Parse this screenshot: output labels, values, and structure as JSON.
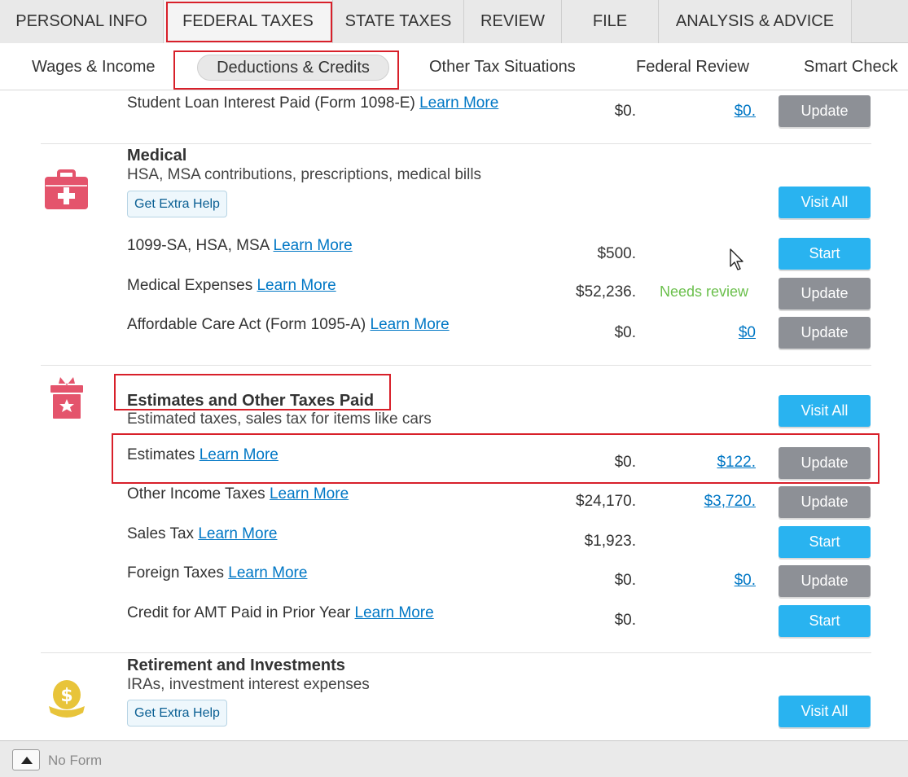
{
  "top_tabs": [
    {
      "label": "PERSONAL INFO"
    },
    {
      "label": "FEDERAL TAXES"
    },
    {
      "label": "STATE TAXES"
    },
    {
      "label": "REVIEW"
    },
    {
      "label": "FILE"
    },
    {
      "label": "ANALYSIS & ADVICE"
    }
  ],
  "active_top_tab": "FEDERAL TAXES",
  "sub_nav": [
    {
      "label": "Wages & Income"
    },
    {
      "label": "Deductions & Credits"
    },
    {
      "label": "Other Tax Situations"
    },
    {
      "label": "Federal Review"
    },
    {
      "label": "Smart Check"
    }
  ],
  "active_sub_tab": "Deductions & Credits",
  "learn_more": "Learn More",
  "student_loan_row": {
    "label": "Student Loan Interest Paid (Form 1098-E)",
    "amount": "$0.",
    "value": "$0.",
    "button": "Update"
  },
  "medical": {
    "title": "Medical",
    "subtitle": "HSA, MSA contributions, prescriptions, medical bills",
    "help": "Get Extra Help",
    "visit_all": "Visit All",
    "rows": [
      {
        "label": "1099-SA, HSA, MSA",
        "amount": "$500.",
        "value": "",
        "button": "Start"
      },
      {
        "label": "Medical Expenses",
        "amount": "$52,236.",
        "status": "Needs review",
        "button": "Update"
      },
      {
        "label": "Affordable Care Act (Form 1095-A)",
        "amount": "$0.",
        "value": "$0",
        "button": "Update"
      }
    ]
  },
  "estimates": {
    "title": "Estimates and Other Taxes Paid",
    "subtitle": "Estimated taxes, sales tax for items like cars",
    "visit_all": "Visit All",
    "rows": [
      {
        "label": "Estimates",
        "amount": "$0.",
        "value": "$122.",
        "button": "Update"
      },
      {
        "label": "Other Income Taxes",
        "amount": "$24,170.",
        "value": "$3,720.",
        "button": "Update"
      },
      {
        "label": "Sales Tax",
        "amount": "$1,923.",
        "value": "",
        "button": "Start"
      },
      {
        "label": "Foreign Taxes",
        "amount": "$0.",
        "value": "$0.",
        "button": "Update"
      },
      {
        "label": "Credit for AMT Paid in Prior Year",
        "amount": "$0.",
        "value": "",
        "button": "Start"
      }
    ]
  },
  "retirement": {
    "title": "Retirement and Investments",
    "subtitle": "IRAs, investment interest expenses",
    "help": "Get Extra Help",
    "visit_all": "Visit All"
  },
  "bottom_bar": {
    "label": "No Form"
  },
  "colors": {
    "accent_blue": "#29b3f0",
    "link": "#0077c5",
    "gray_button": "#8d9096",
    "annotation_red": "#d8202a",
    "needs_review": "#6abf4b"
  },
  "icons": {
    "medical": "medical-kit-icon",
    "estimates": "tax-box-icon",
    "retirement": "money-bag-icon",
    "cursor": "mouse-pointer-icon"
  }
}
